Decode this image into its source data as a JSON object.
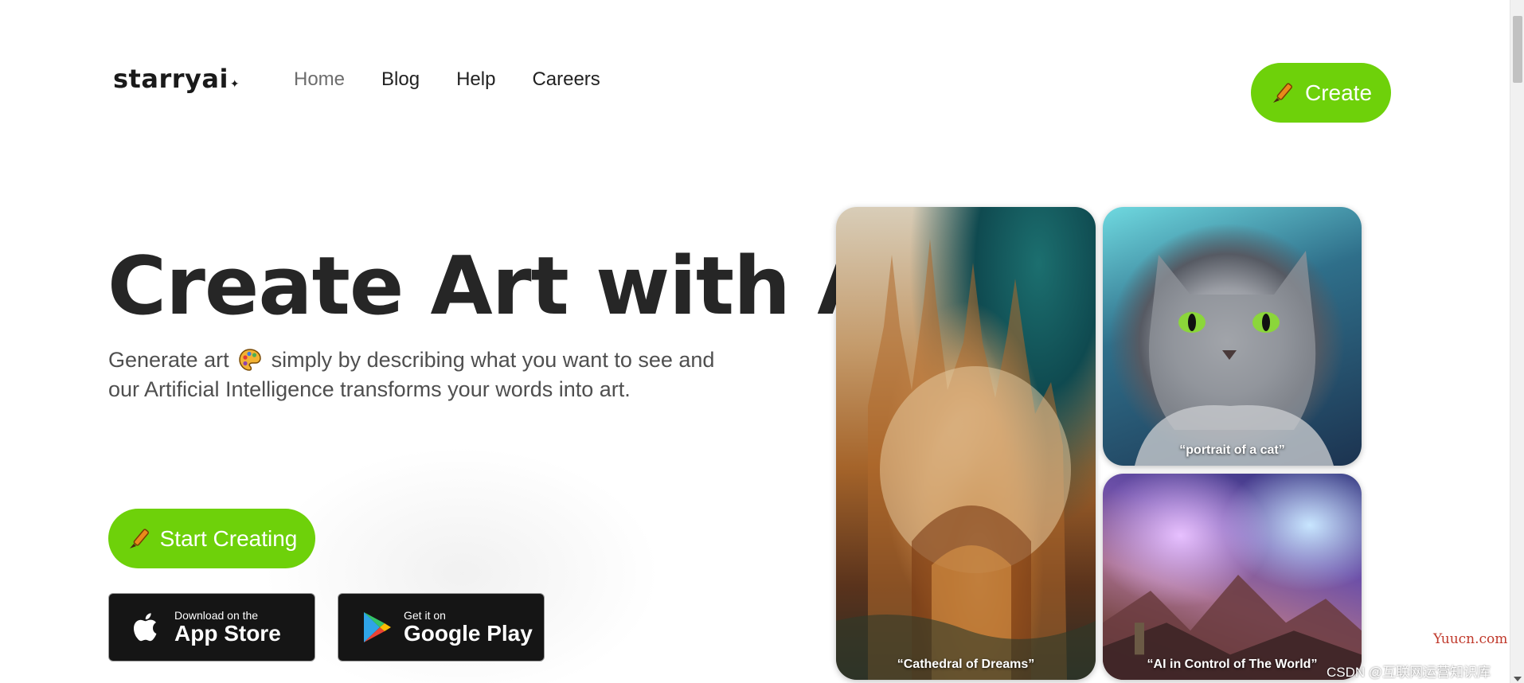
{
  "header": {
    "logo_text": "starryai",
    "logo_star": "✦",
    "nav": [
      {
        "label": "Home",
        "active": true
      },
      {
        "label": "Blog",
        "active": false
      },
      {
        "label": "Help",
        "active": false
      },
      {
        "label": "Careers",
        "active": false
      }
    ],
    "create_label": "Create"
  },
  "hero": {
    "title": "Create Art with AI",
    "subtitle_before": "Generate art",
    "subtitle_after": "simply by describing what you want to see and our Artificial Intelligence transforms your words into art.",
    "start_label": "Start Creating"
  },
  "stores": {
    "apple": {
      "small": "Download on the",
      "big": "App Store"
    },
    "google": {
      "small": "Get it on",
      "big": "Google Play"
    }
  },
  "gallery": [
    {
      "caption": "“Cathedral of Dreams”"
    },
    {
      "caption": "“portrait of a cat”"
    },
    {
      "caption": "“AI in Control of The World”"
    }
  ],
  "watermark": {
    "site": "Yuucn.com",
    "csdn": "CSDN @互联网运营知识库"
  },
  "colors": {
    "accent": "#6ed10a",
    "store_bg": "#151515",
    "title": "#262626"
  },
  "icons": [
    "brush-icon",
    "palette-icon",
    "apple-icon",
    "google-play-icon"
  ]
}
